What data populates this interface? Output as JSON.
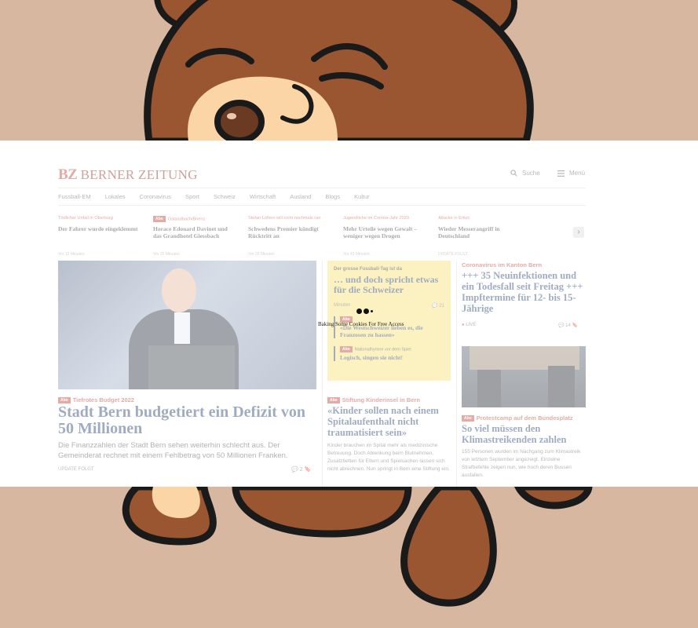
{
  "brand": {
    "short": "BZ",
    "name": "BERNER ZEITUNG"
  },
  "header": {
    "search_label": "Suche",
    "menu_label": "Menü"
  },
  "nav": [
    "Fussball-EM",
    "Lokales",
    "Coronavirus",
    "Sport",
    "Schweiz",
    "Wirtschaft",
    "Ausland",
    "Blogs",
    "Kultur"
  ],
  "ticker": [
    {
      "kicker": "Tödlicher Unfall in Oberburg",
      "title": "Der Fahrer wurde eingeklemmt",
      "time": "Vor 12 Minuten",
      "abo": ""
    },
    {
      "kicker": "Gstaadbach/Brienz",
      "title": "Horace Edouard Davinet und das Grandhotel Giessbach",
      "time": "Vor 20 Minuten",
      "abo": "Abo"
    },
    {
      "kicker": "Stefan Löfven will nicht nochmals ran",
      "title": "Schwedens Premier kündigt Rücktritt an",
      "time": "Vor 29 Minuten",
      "abo": ""
    },
    {
      "kicker": "Jugendliche im Corona-Jahr 2020",
      "title": "Mehr Urteile wegen Gewalt – weniger wegen Drogen",
      "time": "Vor 43 Minuten",
      "abo": ""
    },
    {
      "kicker": "Attacke in Erfurt",
      "title": "Wieder Messerangriff in Deutschland",
      "time": "UPDATE FOLGT",
      "abo": ""
    }
  ],
  "hero": {
    "abo": "Abo",
    "kicker": "Tiefrotes Budget 2022",
    "title": "Stadt Bern budgetiert ein Defizit von 50 Millionen",
    "lead": "Die Finanzzahlen der Stadt Bern sehen weiterhin schlecht aus. Der Gemeinderat rechnet mit einem Fehlbetrag von 50 Millionen Franken.",
    "footer": "UPDATE FOLGT",
    "comments": "2"
  },
  "yellow_box": {
    "kicker": "Der grosse Fussball-Tag ist da",
    "title": "… und doch spricht etwas für die Schweizer",
    "meta": "Minuten",
    "comments": "21",
    "quotes": [
      {
        "abo": "Abo",
        "kicker": "",
        "title": "«Die Westschweizer lieben es, die Franzosen zu hassen»"
      },
      {
        "abo": "Abo",
        "kicker": "Nationalhymne vor dem Spiel",
        "title": "Logisch, singen sie nicht!"
      }
    ]
  },
  "middle": {
    "abo": "Abo",
    "kicker": "Stiftung Kinderinsel in Bern",
    "title": "«Kinder sollen nach einem Spitalaufenthalt nicht traumatisiert sein»",
    "lead": "Kinder brauchen im Spital mehr als medizinische Betreuung. Doch Ablenkung beim Blutnehmen, Zusatzbetten für Eltern und Spielsachen lassen sich nicht abrechnen. Nun springt in Bern eine Stiftung ein."
  },
  "right_top": {
    "kicker": "Coronavirus im Kanton Bern",
    "title": "+++ 35 Neuinfektionen und ein Todesfall seit Freitag +++ Impftermine für 12- bis 15-Jährige",
    "live": "LIVE",
    "comments": "14"
  },
  "right_bottom": {
    "abo": "Abo",
    "kicker": "Protestcamp auf dem Bundesplatz",
    "title": "So viel müssen den Klimastreikenden zahlen",
    "lead": "155 Personen wurden im Nachgang zum Klimastreik von letztem September angezeigt. Einzelne Strafbefehle zeigen nun, wie hoch deren Bussen ausfallen."
  },
  "loader": {
    "text": "Baking Some Cookies For Free Access"
  },
  "colors": {
    "backdrop": "#d7b7a0",
    "bear_fur": "#9a5630",
    "bear_snout": "#fbd5a5",
    "accent": "#c0392b",
    "headline": "#1c3a6b",
    "highlight_box": "#f9df6d"
  }
}
